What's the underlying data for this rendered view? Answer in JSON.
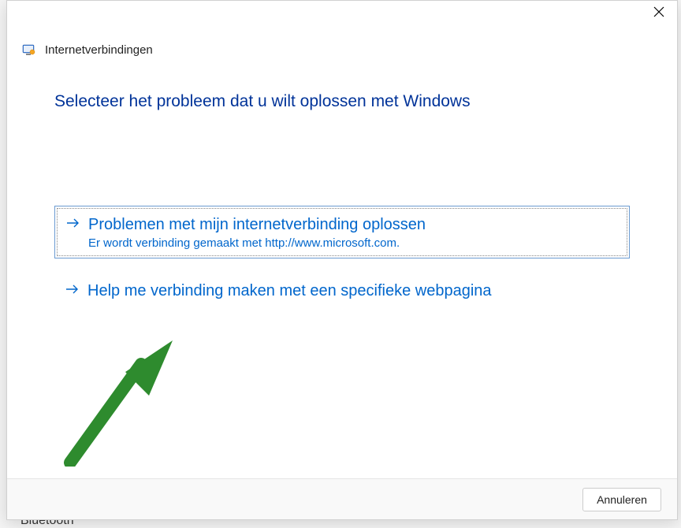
{
  "window": {
    "title": "Internetverbindingen"
  },
  "heading": "Selecteer het probleem dat u wilt oplossen met Windows",
  "options": [
    {
      "title": "Problemen met mijn internetverbinding oplossen",
      "subtitle": "Er wordt verbinding gemaakt met http://www.microsoft.com."
    },
    {
      "title": "Help me verbinding maken met een specifieke webpagina"
    }
  ],
  "footer": {
    "cancel": "Annuleren"
  },
  "bg_hint": "Bluetooth"
}
